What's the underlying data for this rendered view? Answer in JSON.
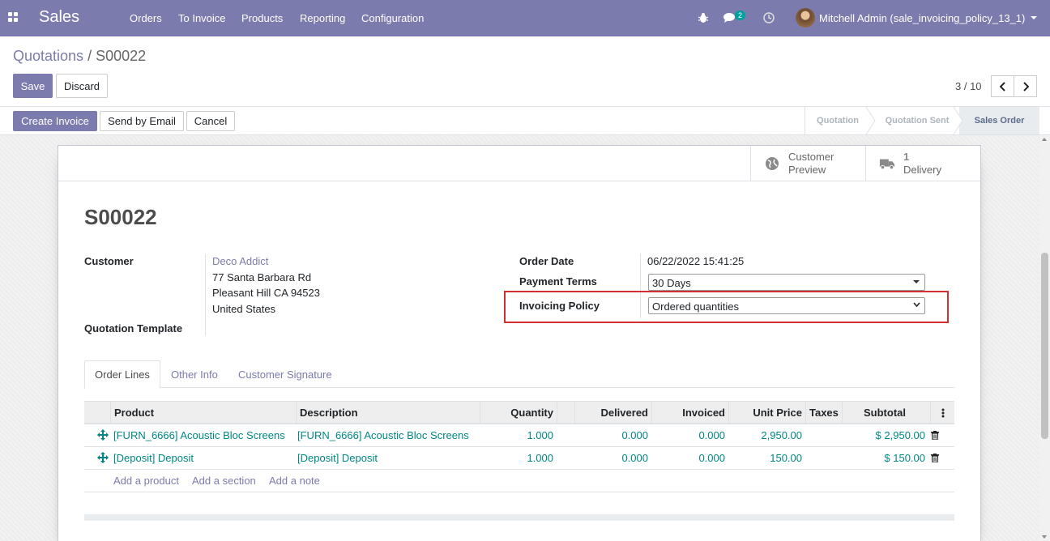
{
  "navbar": {
    "brand": "Sales",
    "menu": [
      "Orders",
      "To Invoice",
      "Products",
      "Reporting",
      "Configuration"
    ],
    "chat_count": "2",
    "user": "Mitchell Admin (sale_invoicing_policy_13_1)"
  },
  "breadcrumb": {
    "parent": "Quotations",
    "separator": "/",
    "current": "S00022"
  },
  "actions": {
    "save": "Save",
    "discard": "Discard"
  },
  "pager": {
    "value": "3 / 10"
  },
  "statusbar": {
    "buttons": [
      "Create Invoice",
      "Send by Email",
      "Cancel"
    ],
    "stages": [
      "Quotation",
      "Quotation Sent",
      "Sales Order"
    ],
    "active_stage": "Sales Order"
  },
  "smart_buttons": {
    "preview": {
      "line1": "Customer",
      "line2": "Preview",
      "icon": "globe-icon"
    },
    "delivery": {
      "count": "1",
      "label": "Delivery",
      "icon": "truck-icon"
    }
  },
  "form": {
    "title": "S00022",
    "customer_label": "Customer",
    "customer_name": "Deco Addict",
    "address": [
      "77 Santa Barbara Rd",
      "Pleasant Hill CA 94523",
      "United States"
    ],
    "template_label": "Quotation Template",
    "order_date_label": "Order Date",
    "order_date": "06/22/2022 15:41:25",
    "payment_terms_label": "Payment Terms",
    "payment_terms": "30 Days",
    "invoicing_policy_label": "Invoicing Policy",
    "invoicing_policy": "Ordered quantities"
  },
  "tabs": [
    "Order Lines",
    "Other Info",
    "Customer Signature"
  ],
  "table": {
    "columns": [
      "Product",
      "Description",
      "Quantity",
      "Delivered",
      "Invoiced",
      "Unit Price",
      "Taxes",
      "Subtotal"
    ],
    "rows": [
      {
        "product": "[FURN_6666] Acoustic Bloc Screens",
        "description": "[FURN_6666] Acoustic Bloc Screens",
        "quantity": "1.000",
        "delivered": "0.000",
        "invoiced": "0.000",
        "unit_price": "2,950.00",
        "taxes": "",
        "subtotal": "$ 2,950.00"
      },
      {
        "product": "[Deposit] Deposit",
        "description": "[Deposit] Deposit",
        "quantity": "1.000",
        "delivered": "0.000",
        "invoiced": "0.000",
        "unit_price": "150.00",
        "taxes": "",
        "subtotal": "$ 150.00"
      }
    ],
    "add_links": [
      "Add a product",
      "Add a section",
      "Add a note"
    ]
  }
}
